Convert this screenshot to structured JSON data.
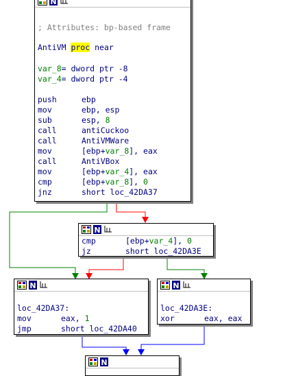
{
  "colors": {
    "edge_true": "#008000",
    "edge_false": "#ff0000",
    "edge_uncond": "#0000ff",
    "code": "#000080",
    "comment": "#808080",
    "highlight": "#ffff00"
  },
  "icons": [
    "graph-overview-icon",
    "node-icon",
    "rename-icon"
  ],
  "main_node": {
    "comment": "; Attributes: bp-based frame",
    "proc_name": "AntiVM",
    "proc_kw": "proc",
    "proc_near": "near",
    "vars": [
      {
        "name": "var_8",
        "decl": "= dword ptr -8"
      },
      {
        "name": "var_4",
        "decl": "= dword ptr -4"
      }
    ],
    "instructions": [
      {
        "mn": "push",
        "pre": "ebp",
        "var": "",
        "post": ""
      },
      {
        "mn": "mov",
        "pre": "ebp, esp",
        "var": "",
        "post": ""
      },
      {
        "mn": "sub",
        "pre": "esp, ",
        "var": "",
        "post": "",
        "num": "8"
      },
      {
        "mn": "call",
        "pre": "antiCuckoo",
        "var": "",
        "post": ""
      },
      {
        "mn": "call",
        "pre": "AntiVMWare",
        "var": "",
        "post": ""
      },
      {
        "mn": "mov",
        "pre": "[ebp+",
        "var": "var_8",
        "post": "], eax"
      },
      {
        "mn": "call",
        "pre": "AntiVBox",
        "var": "",
        "post": ""
      },
      {
        "mn": "mov",
        "pre": "[ebp+",
        "var": "var_4",
        "post": "], eax"
      },
      {
        "mn": "cmp",
        "pre": "[ebp+",
        "var": "var_8",
        "post": "], ",
        "num": "0"
      },
      {
        "mn": "jnz",
        "pre": "short loc_42DA37",
        "var": "",
        "post": ""
      }
    ]
  },
  "cmp_node": {
    "instructions": [
      {
        "mn": "cmp",
        "pre": "[ebp+",
        "var": "var_4",
        "post": "], ",
        "num": "0"
      },
      {
        "mn": "jz",
        "pre": "short loc_42DA3E",
        "var": "",
        "post": ""
      }
    ]
  },
  "left_node": {
    "label": "loc_42DA37:",
    "instructions": [
      {
        "mn": "mov",
        "pre": "eax, ",
        "var": "",
        "post": "",
        "num": "1"
      },
      {
        "mn": "jmp",
        "pre": "short loc_42DA40",
        "var": "",
        "post": ""
      }
    ]
  },
  "right_node": {
    "label": "loc_42DA3E:",
    "instructions": [
      {
        "mn": "xor",
        "pre": "eax, eax",
        "var": "",
        "post": ""
      }
    ]
  }
}
